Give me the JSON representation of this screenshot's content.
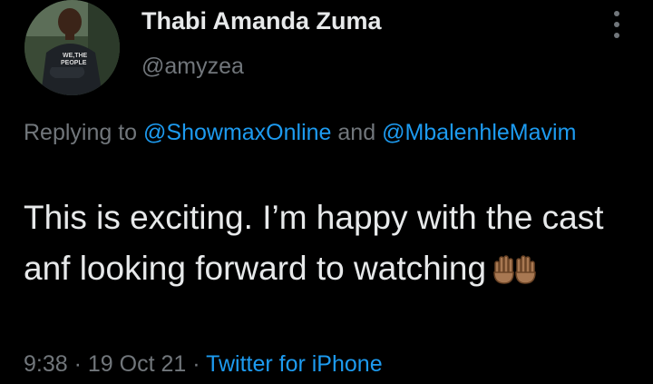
{
  "tweet": {
    "author": {
      "display_name": "Thabi Amanda Zuma",
      "handle": "@amyzea",
      "avatar_shirt_text": "WE,THE PEOPLE"
    },
    "more_icon": "more-vertical-icon",
    "reply": {
      "prefix": "Replying to ",
      "mention_1": "@ShowmaxOnline",
      "joiner": " and ",
      "mention_2": "@MbalenhleMavim"
    },
    "text": "This is exciting. I’m happy with the cast anf looking forward to watching",
    "emoji": "raising-hands-emoji",
    "meta": {
      "time": "9:38",
      "separator": " · ",
      "date": "19 Oct 21",
      "source": "Twitter for iPhone"
    }
  },
  "colors": {
    "background": "#000000",
    "primary_text": "#e7e9ea",
    "secondary_text": "#71767b",
    "link": "#1d9bf0"
  }
}
